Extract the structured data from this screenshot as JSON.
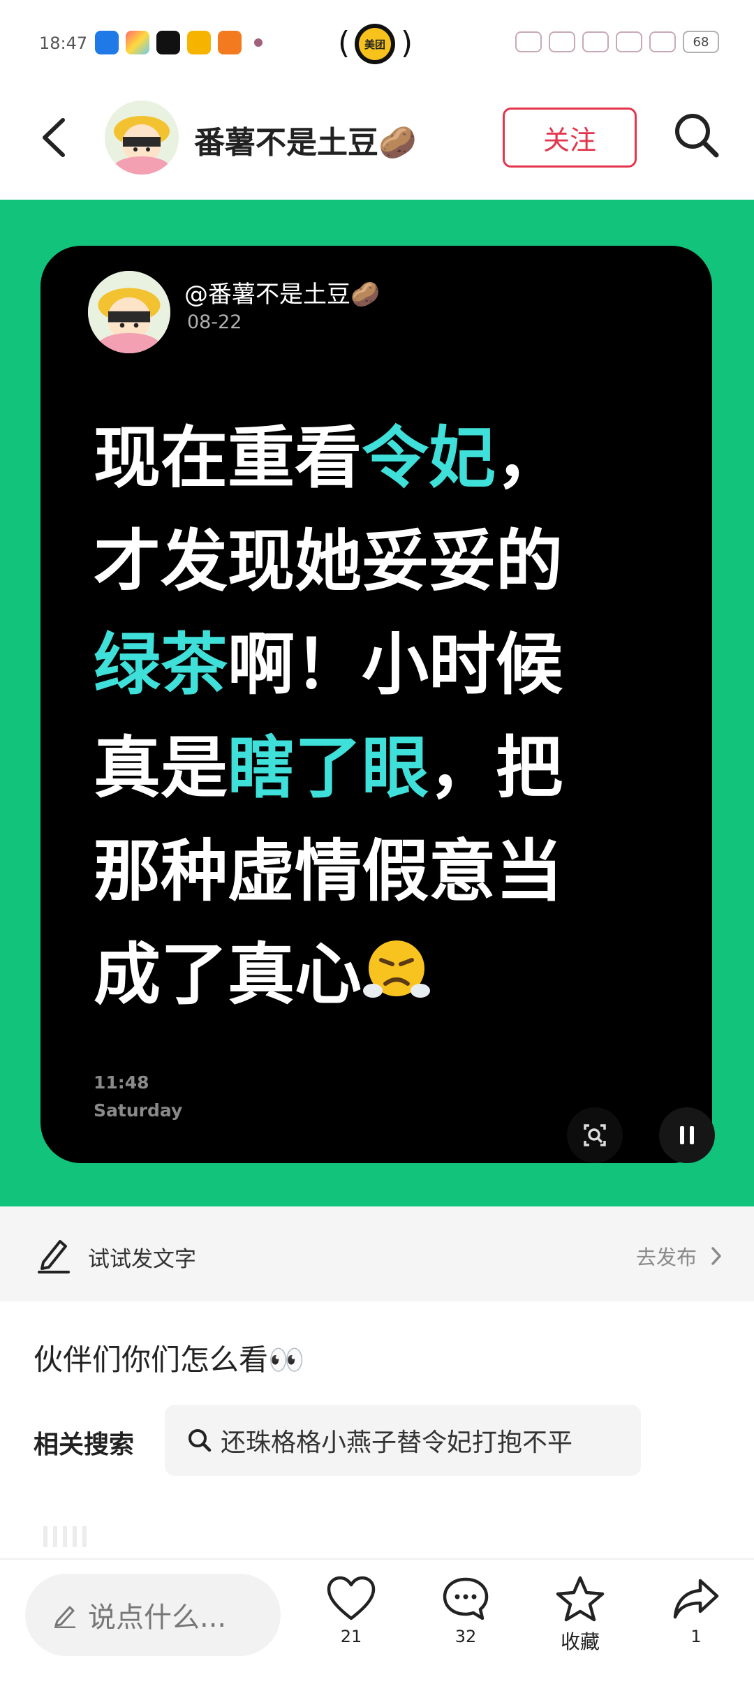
{
  "status_bar": {
    "time": "18:47",
    "island_label": "美团",
    "battery": "68"
  },
  "header": {
    "username": "番薯不是土豆🥔",
    "follow_label": "关注"
  },
  "post_card": {
    "handle": "@番薯不是土豆🥔",
    "date": "08-22",
    "text_lines": {
      "l1a": "现在重看",
      "l1b": "令妃",
      "l1c": "，",
      "l2": "才发现她妥妥的",
      "l3a": "绿茶",
      "l3b": "啊！小时候",
      "l4a": "真是",
      "l4b": "瞎了眼",
      "l4c": "，把",
      "l5": "那种虚情假意当",
      "l6": "成了真心"
    },
    "time": "11:48",
    "day": "Saturday",
    "highlight_color": "#3fe0d9",
    "background_color": "#12c37c"
  },
  "compose": {
    "label": "试试发文字",
    "publish_label": "去发布"
  },
  "caption": "伙伴们你们怎么看👀",
  "related": {
    "label": "相关搜索",
    "query": "还珠格格小燕子替令妃打抱不平"
  },
  "bottom_bar": {
    "comment_placeholder": "说点什么...",
    "like_count": "21",
    "comment_count": "32",
    "collect_label": "收藏",
    "share_count": "1"
  }
}
